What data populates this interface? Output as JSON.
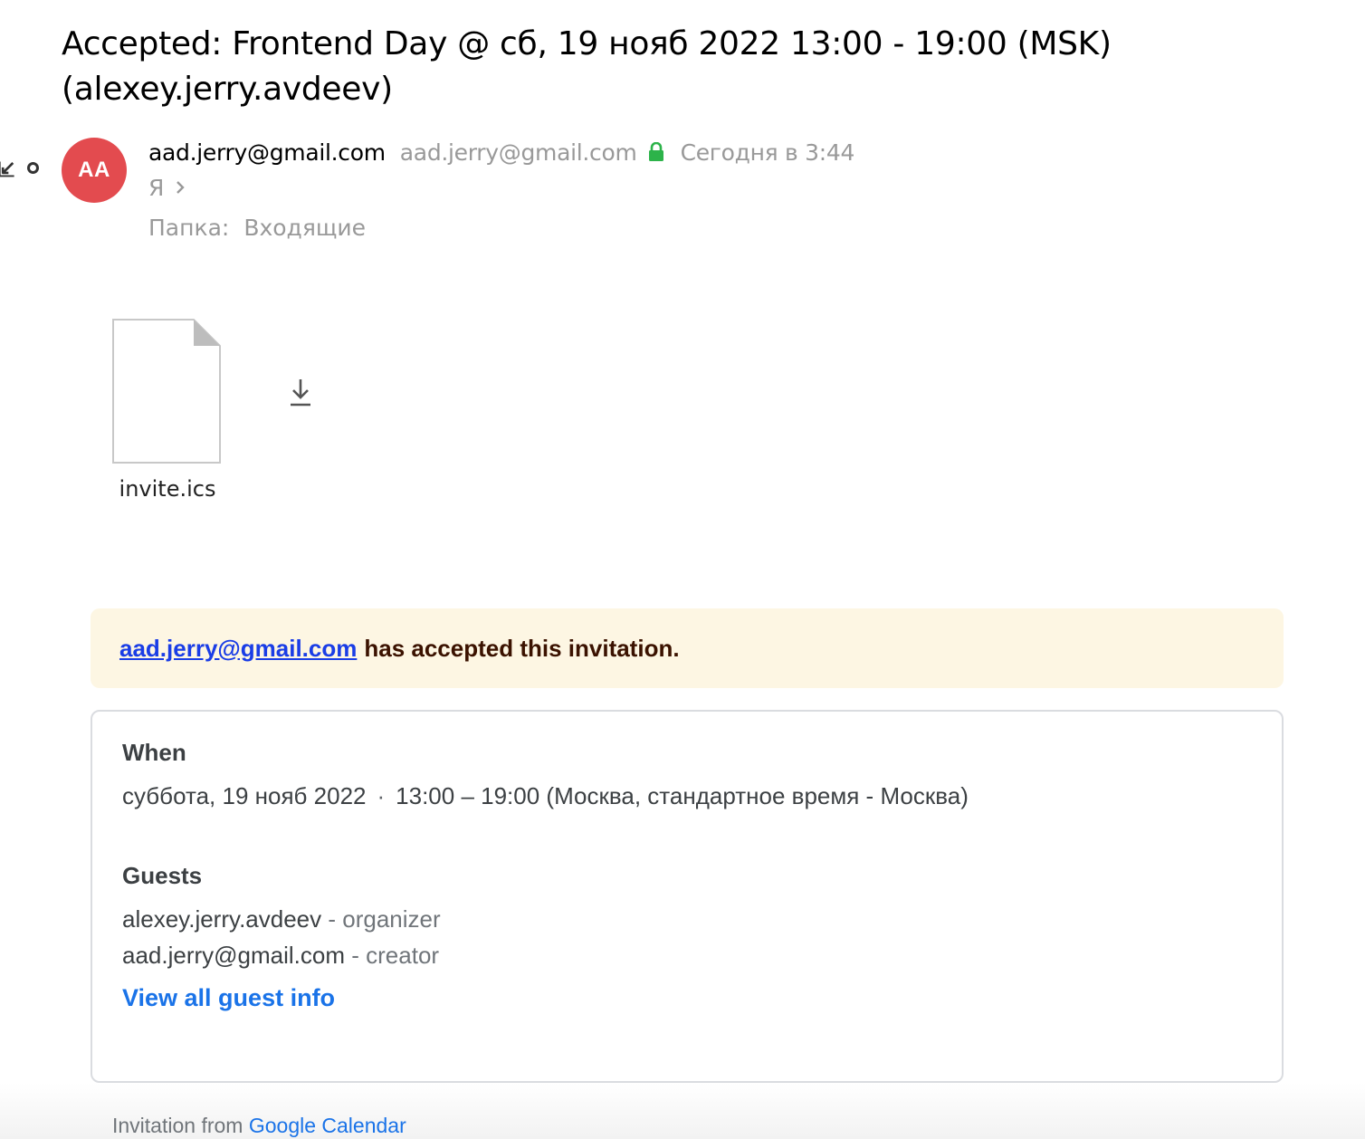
{
  "message": {
    "subject": "Accepted: Frontend Day @ сб, 19 нояб 2022 13:00 - 19:00 (MSK) (alexey.jerry.avdeev)",
    "avatar_initials": "AA",
    "avatar_color": "#e34b4f",
    "from_name": "aad.jerry@gmail.com",
    "from_email": "aad.jerry@gmail.com",
    "date": "Сегодня в 3:44",
    "to": "Я",
    "folder_label": "Папка:",
    "folder_name": "Входящие"
  },
  "attachment": {
    "file_name": "invite.ics",
    "icon": "file-icon",
    "download_icon": "download-icon"
  },
  "invite": {
    "banner_email": "aad.jerry@gmail.com",
    "banner_text": "has accepted this invitation.",
    "when_label": "When",
    "when_date": "суббота, 19 нояб 2022",
    "when_separator": "·",
    "when_time": "13:00 – 19:00 (Москва, стандартное время - Москва)",
    "guests_label": "Guests",
    "guests": [
      {
        "name": "alexey.jerry.avdeev",
        "role": "- organizer"
      },
      {
        "name": "aad.jerry@gmail.com",
        "role": "- creator"
      }
    ],
    "view_all_label": "View all guest info",
    "footer_prefix": "Invitation from",
    "footer_link": "Google Calendar"
  },
  "colors": {
    "banner_bg": "#fdf6e3",
    "link_blue": "#1a73e8",
    "secure_green": "#2db34a"
  }
}
